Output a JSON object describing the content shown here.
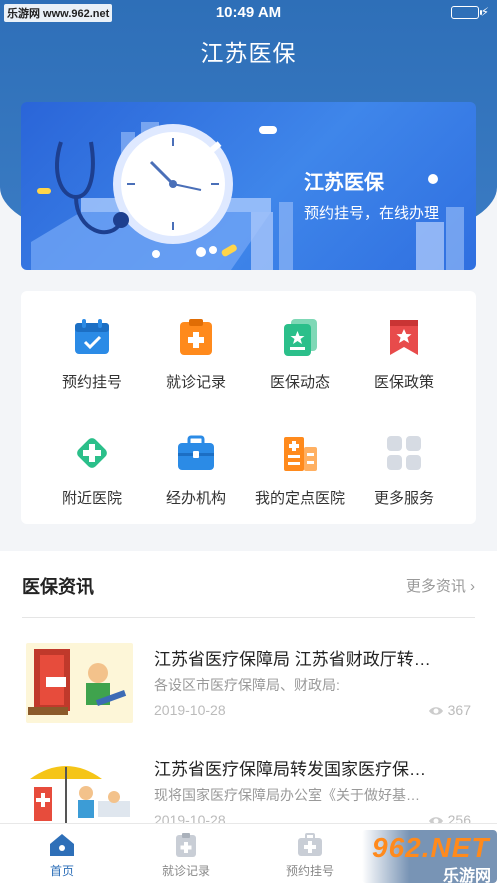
{
  "status_bar": {
    "watermark": "乐游网 www.962.net",
    "time": "10:49 AM"
  },
  "header": {
    "title": "江苏医保"
  },
  "banner": {
    "title": "江苏医保",
    "subtitle": "预约挂号，在线办理"
  },
  "services": [
    {
      "label": "预约挂号",
      "icon": "calendar-check-icon",
      "color": "#2b8be6"
    },
    {
      "label": "就诊记录",
      "icon": "clipboard-plus-icon",
      "color": "#ff8a1c"
    },
    {
      "label": "医保动态",
      "icon": "document-star-icon",
      "color": "#2bbf8a"
    },
    {
      "label": "医保政策",
      "icon": "bookmark-star-icon",
      "color": "#e84b4b"
    },
    {
      "label": "附近医院",
      "icon": "medical-cross-icon",
      "color": "#2bbf8a"
    },
    {
      "label": "经办机构",
      "icon": "toolbox-icon",
      "color": "#2b8be6"
    },
    {
      "label": "我的定点医院",
      "icon": "hospital-building-icon",
      "color": "#ff8a1c"
    },
    {
      "label": "更多服务",
      "icon": "grid-icon",
      "color": "#d6dbe3"
    }
  ],
  "news": {
    "heading": "医保资讯",
    "more_label": "更多资讯",
    "items": [
      {
        "title": "江苏省医疗保障局 江苏省财政厅转…",
        "summary": "各设区市医疗保障局、财政局:",
        "date": "2019-10-28",
        "views": "367"
      },
      {
        "title": "江苏省医疗保障局转发国家医疗保…",
        "summary": "现将国家医疗保障局办公室《关于做好基…",
        "date": "2019-10-28",
        "views": "256"
      }
    ]
  },
  "tabbar": {
    "items": [
      {
        "label": "首页",
        "icon": "home-icon",
        "active": true
      },
      {
        "label": "就诊记录",
        "icon": "clipboard-plus-icon",
        "active": false
      },
      {
        "label": "预约挂号",
        "icon": "medical-kit-icon",
        "active": false
      }
    ]
  },
  "brand_watermark": {
    "main": "962.NET",
    "sub": "乐游网"
  },
  "colors": {
    "primary": "#2e6fb8",
    "accent": "#ff8a1c"
  }
}
